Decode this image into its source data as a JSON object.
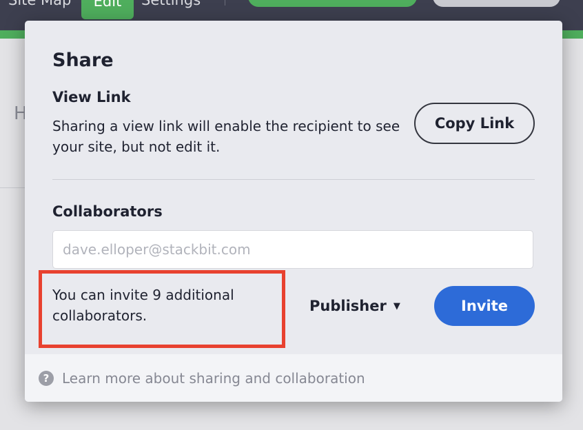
{
  "topbar": {
    "nav_items": [
      "Site Map",
      "Edit",
      "Settings"
    ]
  },
  "background": {
    "fragment_text": "H"
  },
  "share_popover": {
    "title": "Share",
    "view_link": {
      "heading": "View Link",
      "description": "Sharing a view link will enable the recipient to see your site, but not edit it.",
      "copy_button_label": "Copy Link"
    },
    "collaborators": {
      "heading": "Collaborators",
      "email_placeholder": "dave.elloper@stackbit.com",
      "email_value": "",
      "invite_note": "You can invite 9 additional collaborators.",
      "role_selected": "Publisher",
      "invite_button_label": "Invite"
    },
    "footer": {
      "help_icon_glyph": "?",
      "help_link_text": "Learn more about sharing and collaboration"
    }
  },
  "colors": {
    "accent_green": "#4fae5d",
    "invite_blue": "#2d6bd8",
    "highlight_red": "#e8412f"
  }
}
